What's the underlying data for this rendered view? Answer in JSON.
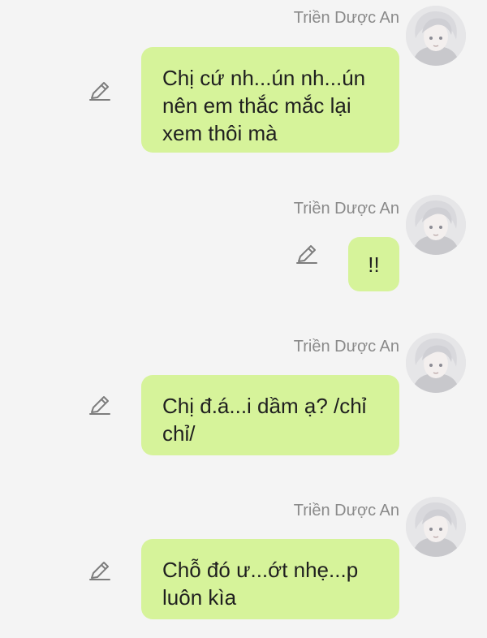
{
  "messages": [
    {
      "sender": "Triền Dược An",
      "text": "Chị cứ nh...ún nh...ún\nnên em thắc mắc lại\nxem thôi mà",
      "edit_icon": "pencil-icon"
    },
    {
      "sender": "Triền Dược An",
      "text": "!!",
      "edit_icon": "pencil-icon"
    },
    {
      "sender": "Triền Dược An",
      "text": "Chị đ.á...i dầm ạ? /chỉ\nchỉ/",
      "edit_icon": "pencil-icon"
    },
    {
      "sender": "Triền Dược An",
      "text": "Chỗ đó ư...ớt nhẹ...p\nluôn kìa",
      "edit_icon": "pencil-icon"
    }
  ],
  "colors": {
    "background": "#f4f4f4",
    "bubble": "#d6f39a",
    "sender_name": "#8a8a8a",
    "message_text": "#1f1f1f",
    "icon": "#7d7d7d"
  }
}
